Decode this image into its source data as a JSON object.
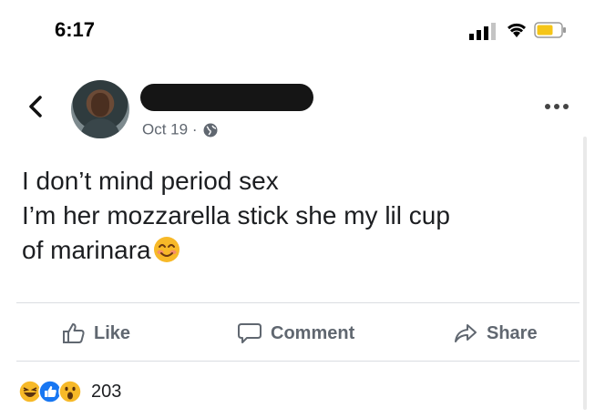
{
  "status_bar": {
    "time": "6:17",
    "signal_icon": "signal-icon",
    "wifi_icon": "wifi-icon",
    "battery_icon": "battery-icon",
    "battery_color": "#f5c518"
  },
  "post": {
    "date": "Oct 19",
    "separator": "·",
    "privacy_icon": "globe-icon",
    "text_lines": [
      "I don’t mind period sex",
      "I’m her mozzarella stick she my lil cup",
      "of marinara"
    ],
    "trailing_emoji": "smiling-face-icon"
  },
  "actions": {
    "like_label": "Like",
    "comment_label": "Comment",
    "share_label": "Share"
  },
  "reactions": {
    "icons": [
      "laugh-reaction-icon",
      "like-reaction-icon",
      "wow-reaction-icon"
    ],
    "count": "203"
  },
  "colors": {
    "secondary_text": "#606770",
    "primary_text": "#1c1e21",
    "like_blue": "#1877f2",
    "reaction_yellow": "#f7b928"
  }
}
